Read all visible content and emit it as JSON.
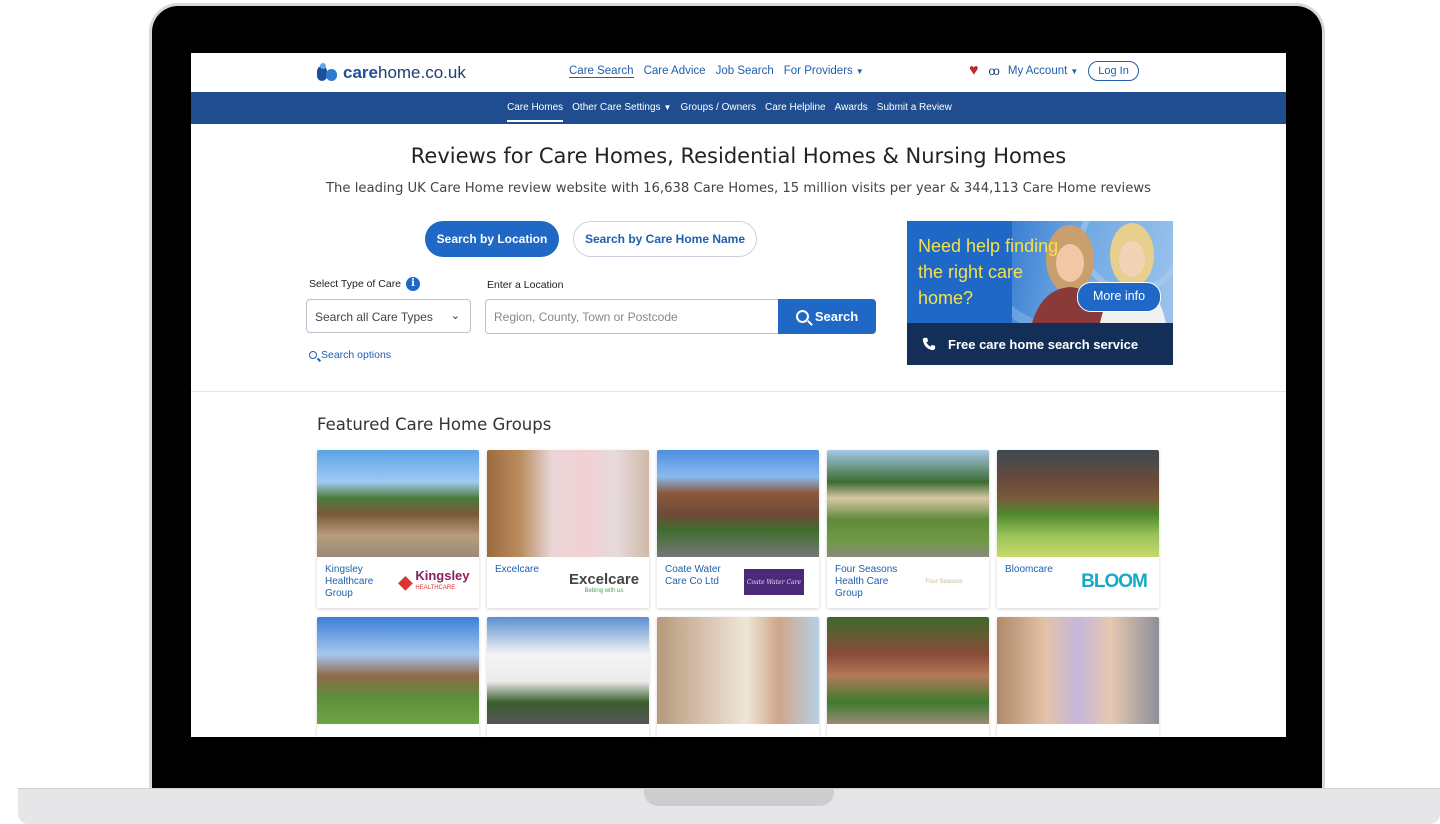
{
  "site": {
    "logo_bold": "care",
    "logo_rest": "home.co.uk"
  },
  "topnav": {
    "links": [
      "Care Search",
      "Care Advice",
      "Job Search",
      "For Providers"
    ],
    "account_label": "My Account",
    "login_label": "Log In"
  },
  "subnav": {
    "links": [
      "Care Homes",
      "Other Care Settings",
      "Groups / Owners",
      "Care Helpline",
      "Awards",
      "Submit a Review"
    ]
  },
  "hero": {
    "title": "Reviews for Care Homes, Residential Homes & Nursing Homes",
    "subtitle": "The leading UK Care Home review website with 16,638 Care Homes, 15 million visits per year & 344,113 Care Home reviews"
  },
  "search": {
    "tab_location": "Search by Location",
    "tab_name": "Search by Care Home Name",
    "type_label": "Select Type of Care",
    "type_value": "Search all Care Types",
    "location_label": "Enter a Location",
    "location_placeholder": "Region, County, Town or Postcode",
    "button_label": "Search",
    "options_label": "Search options"
  },
  "ad": {
    "headline": "Need help finding the right care home?",
    "more_info": "More info",
    "bar_text": "Free care home search service"
  },
  "featured": {
    "title": "Featured Care Home Groups",
    "groups": [
      {
        "name": "Kingsley Healthcare Group",
        "logo_text": "Kingsley",
        "logo_sub": "HEALTHCARE",
        "logo_color": "#8a1f5c"
      },
      {
        "name": "Excelcare",
        "logo_text": "Excelcare",
        "logo_sub": "Bebing with us",
        "logo_color": "#444444"
      },
      {
        "name": "Coate Water Care Co Ltd",
        "logo_text": "Coate Water Care",
        "logo_sub": "",
        "logo_color": "#4b2a7a"
      },
      {
        "name": "Four Seasons Health Care Group",
        "logo_text": "Four Seasons",
        "logo_sub": "",
        "logo_color": "#c8b98a"
      },
      {
        "name": "Bloomcare",
        "logo_text": "BLOOM",
        "logo_sub": "",
        "logo_color": "#1aa8c9"
      }
    ]
  },
  "colors": {
    "primary": "#1f68c5",
    "navy": "#1f4d8f",
    "ad_bar": "#132f57",
    "ad_text": "#f4e04d"
  }
}
